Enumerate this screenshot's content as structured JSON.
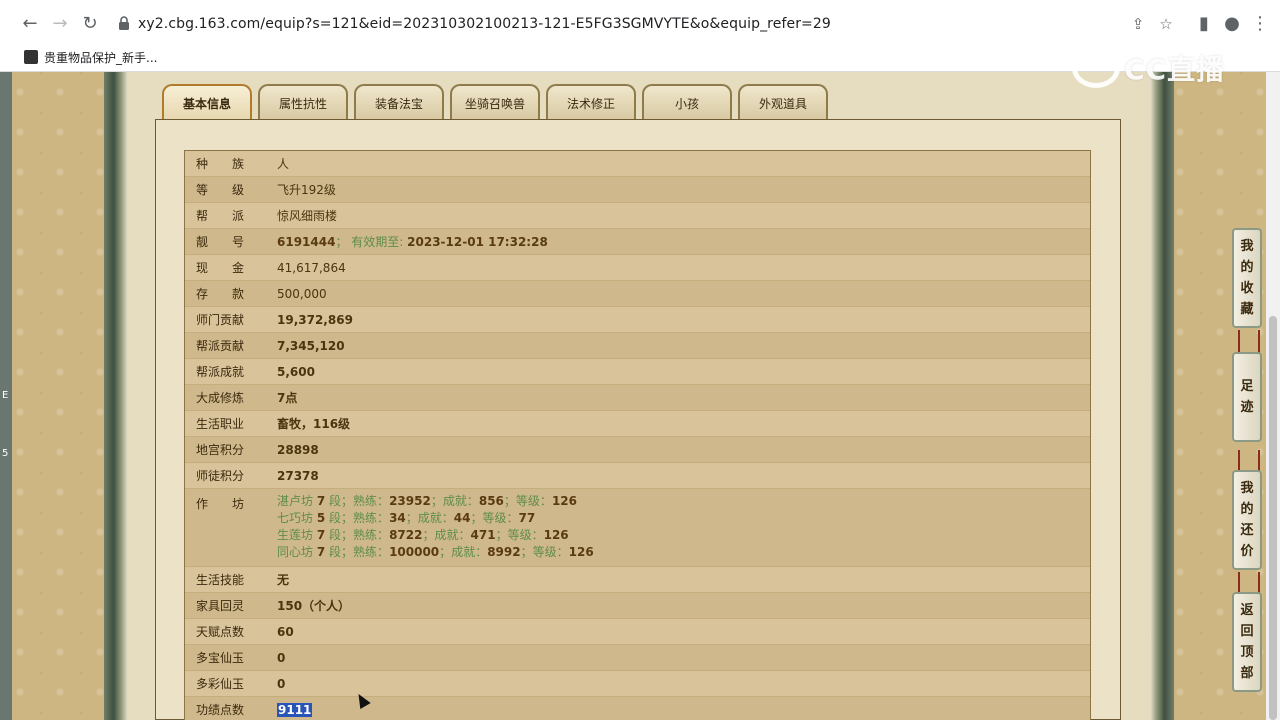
{
  "browser": {
    "url": "xy2.cbg.163.com/equip?s=121&eid=202310302100213-121-E5FG3SGMVYTE&o&equip_refer=29",
    "bookmark": "贵重物品保护_新手..."
  },
  "watermark": "CC直播",
  "tabs": [
    "基本信息",
    "属性抗性",
    "装备法宝",
    "坐骑召唤兽",
    "法术修正",
    "小孩",
    "外观道具"
  ],
  "rows": [
    {
      "key": "种　　族",
      "value": "人"
    },
    {
      "key": "等　　级",
      "value": "飞升192级"
    },
    {
      "key": "帮　　派",
      "value": "惊风细雨楼"
    },
    {
      "key": "靓　　号",
      "value": "6191444",
      "extra_label": "有效期至:",
      "extra_value": "2023-12-01 17:32:28"
    },
    {
      "key": "现　　金",
      "value": "41,617,864"
    },
    {
      "key": "存　　款",
      "value": "500,000"
    },
    {
      "key": "师门贡献",
      "value": "19,372,869"
    },
    {
      "key": "帮派贡献",
      "value": "7,345,120"
    },
    {
      "key": "帮派成就",
      "value": "5,600"
    },
    {
      "key": "大成修炼",
      "value": "7点"
    },
    {
      "key": "生活职业",
      "value": "畜牧，116级"
    },
    {
      "key": "地宫积分",
      "value": "28898"
    },
    {
      "key": "师徒积分",
      "value": "27378"
    },
    {
      "key": "作　　坊",
      "workshops": [
        {
          "name": "湛卢坊",
          "level": "7",
          "skill": "23952",
          "achievement": "856",
          "grade": "126"
        },
        {
          "name": "七巧坊",
          "level": "5",
          "skill": "34",
          "achievement": "44",
          "grade": "77"
        },
        {
          "name": "生莲坊",
          "level": "7",
          "skill": "8722",
          "achievement": "471",
          "grade": "126"
        },
        {
          "name": "同心坊",
          "level": "7",
          "skill": "100000",
          "achievement": "8992",
          "grade": "126"
        }
      ]
    },
    {
      "key": "生活技能",
      "value": "无"
    },
    {
      "key": "家具回灵",
      "value": "150（个人）"
    },
    {
      "key": "天赋点数",
      "value": "60"
    },
    {
      "key": "多宝仙玉",
      "value": "0"
    },
    {
      "key": "多彩仙玉",
      "value": "0"
    },
    {
      "key": "功绩点数",
      "value": "9111"
    }
  ],
  "workshop_labels": {
    "duan": "段；",
    "skill": "熟练：",
    "achievement": "成就：",
    "grade": "等级："
  },
  "side_buttons": [
    {
      "chars": [
        "我",
        "的",
        "收",
        "藏"
      ]
    },
    {
      "chars": [
        "足",
        "迹"
      ]
    },
    {
      "chars": [
        "我",
        "的",
        "还",
        "价"
      ]
    },
    {
      "chars": [
        "返",
        "回",
        "顶",
        "部"
      ]
    }
  ],
  "colors": {
    "page_bg": "#cdb682",
    "row_odd": "#d8c39a",
    "row_even": "#cfb88b",
    "cash": "#27c9c2",
    "deposit": "#d0189a",
    "text_green": "#5e8d4a"
  }
}
